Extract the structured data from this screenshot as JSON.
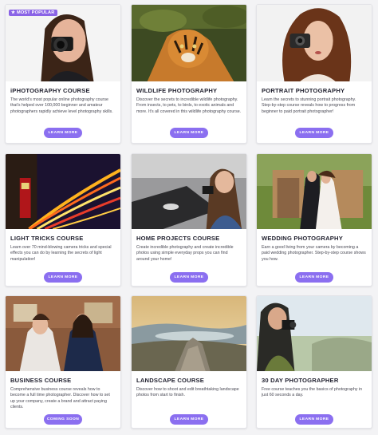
{
  "colors": {
    "accent": "#8b6ff0",
    "badge": "#8a63e6",
    "title": "#222230",
    "text": "#4a4a55"
  },
  "cards": [
    {
      "badge": "★ MOST POPULAR",
      "title": "iPHOTOGRAPHY COURSE",
      "description": "The world's most popular online photography course that's helped over 100,000 beginner and amateur photographers rapidly achieve level photography skills.",
      "button": "LEARN MORE",
      "image": "woman-with-camera-photo"
    },
    {
      "title": "WILDLIFE PHOTOGRAPHY",
      "description": "Discover the secrets to incredible wildlife photography. From insects, to pets, to birds, to exotic animals and more. It's all covered in this wildlife photography course.",
      "button": "LEARN MORE",
      "image": "tiger-photo"
    },
    {
      "title": "PORTRAIT PHOTOGRAPHY",
      "description": "Learn the secrets to stunning portrait photography. Step-by-step course reveals how to progress from beginner to paid portrait photographer!",
      "button": "LEARN MORE",
      "image": "curly-hair-woman-camera-photo"
    },
    {
      "title": "LIGHT TRICKS COURSE",
      "description": "Learn over 70 mind-blowing camera tricks and special effects you can do by learning the secrets of light manipulation!",
      "button": "LEARN MORE",
      "image": "light-trails-london-photo"
    },
    {
      "title": "HOME PROJECTS COURSE",
      "description": "Create incredible photography and create incredible photos using simple everyday props you can find around your home!",
      "button": "LEARN MORE",
      "image": "home-studio-photo"
    },
    {
      "title": "WEDDING PHOTOGRAPHY",
      "description": "Earn a good living from your camera by becoming a paid wedding photographer. Step-by-step course shows you how.",
      "button": "LEARN MORE",
      "image": "wedding-couple-photo"
    },
    {
      "title": "BUSINESS COURSE",
      "description": "Comprehensive business course reveals how to become a full time photographer. Discover how to set up your company, create a brand and attract paying clients.",
      "button": "COMING SOON",
      "image": "two-women-photo"
    },
    {
      "title": "LANDSCAPE COURSE",
      "description": "Discover how to shoot and edit breathtaking landscape photos from start to finish.",
      "button": "LEARN MORE",
      "image": "landscape-rocks-lake-photo"
    },
    {
      "title": "30 DAY PHOTOGRAPHER",
      "description": "Free course teaches you the basics of photography in just 60 seconds a day.",
      "button": "LEARN MORE",
      "image": "woman-shooting-coast-photo"
    }
  ]
}
